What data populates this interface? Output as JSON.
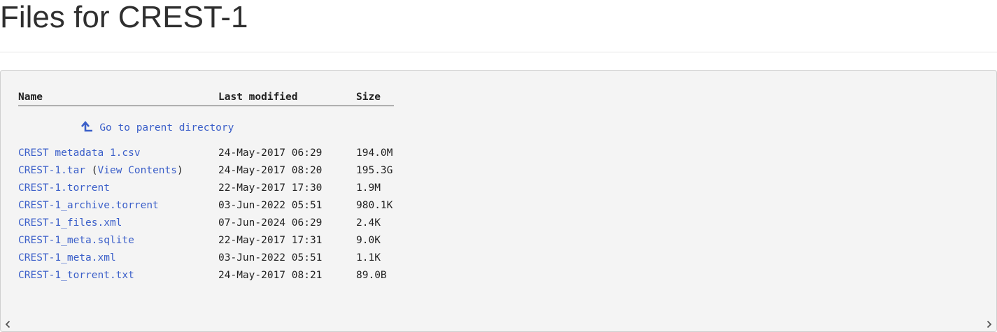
{
  "page": {
    "title": "Files for CREST-1"
  },
  "listing": {
    "columns": {
      "name": "Name",
      "modified": "Last modified",
      "size": "Size"
    },
    "parent": {
      "icon": "arrow-up-parent-icon",
      "label": "Go to parent directory"
    },
    "files": [
      {
        "name": "CREST metadata 1.csv",
        "modified": "24-May-2017 06:29",
        "size": "194.0M"
      },
      {
        "name": "CREST-1.tar",
        "extra_open": " (",
        "extra_link": "View Contents",
        "extra_close": ")",
        "modified": "24-May-2017 08:20",
        "size": "195.3G"
      },
      {
        "name": "CREST-1.torrent",
        "modified": "22-May-2017 17:30",
        "size": "1.9M"
      },
      {
        "name": "CREST-1_archive.torrent",
        "modified": "03-Jun-2022 05:51",
        "size": "980.1K"
      },
      {
        "name": "CREST-1_files.xml",
        "modified": "07-Jun-2024 06:29",
        "size": "2.4K"
      },
      {
        "name": "CREST-1_meta.sqlite",
        "modified": "22-May-2017 17:31",
        "size": "9.0K"
      },
      {
        "name": "CREST-1_meta.xml",
        "modified": "03-Jun-2022 05:51",
        "size": "1.1K"
      },
      {
        "name": "CREST-1_torrent.txt",
        "modified": "24-May-2017 08:21",
        "size": "89.0B"
      }
    ]
  },
  "colors": {
    "link": "#3b5fc9",
    "panel_bg": "#f4f4f4",
    "title_text": "#2f2f2f"
  }
}
